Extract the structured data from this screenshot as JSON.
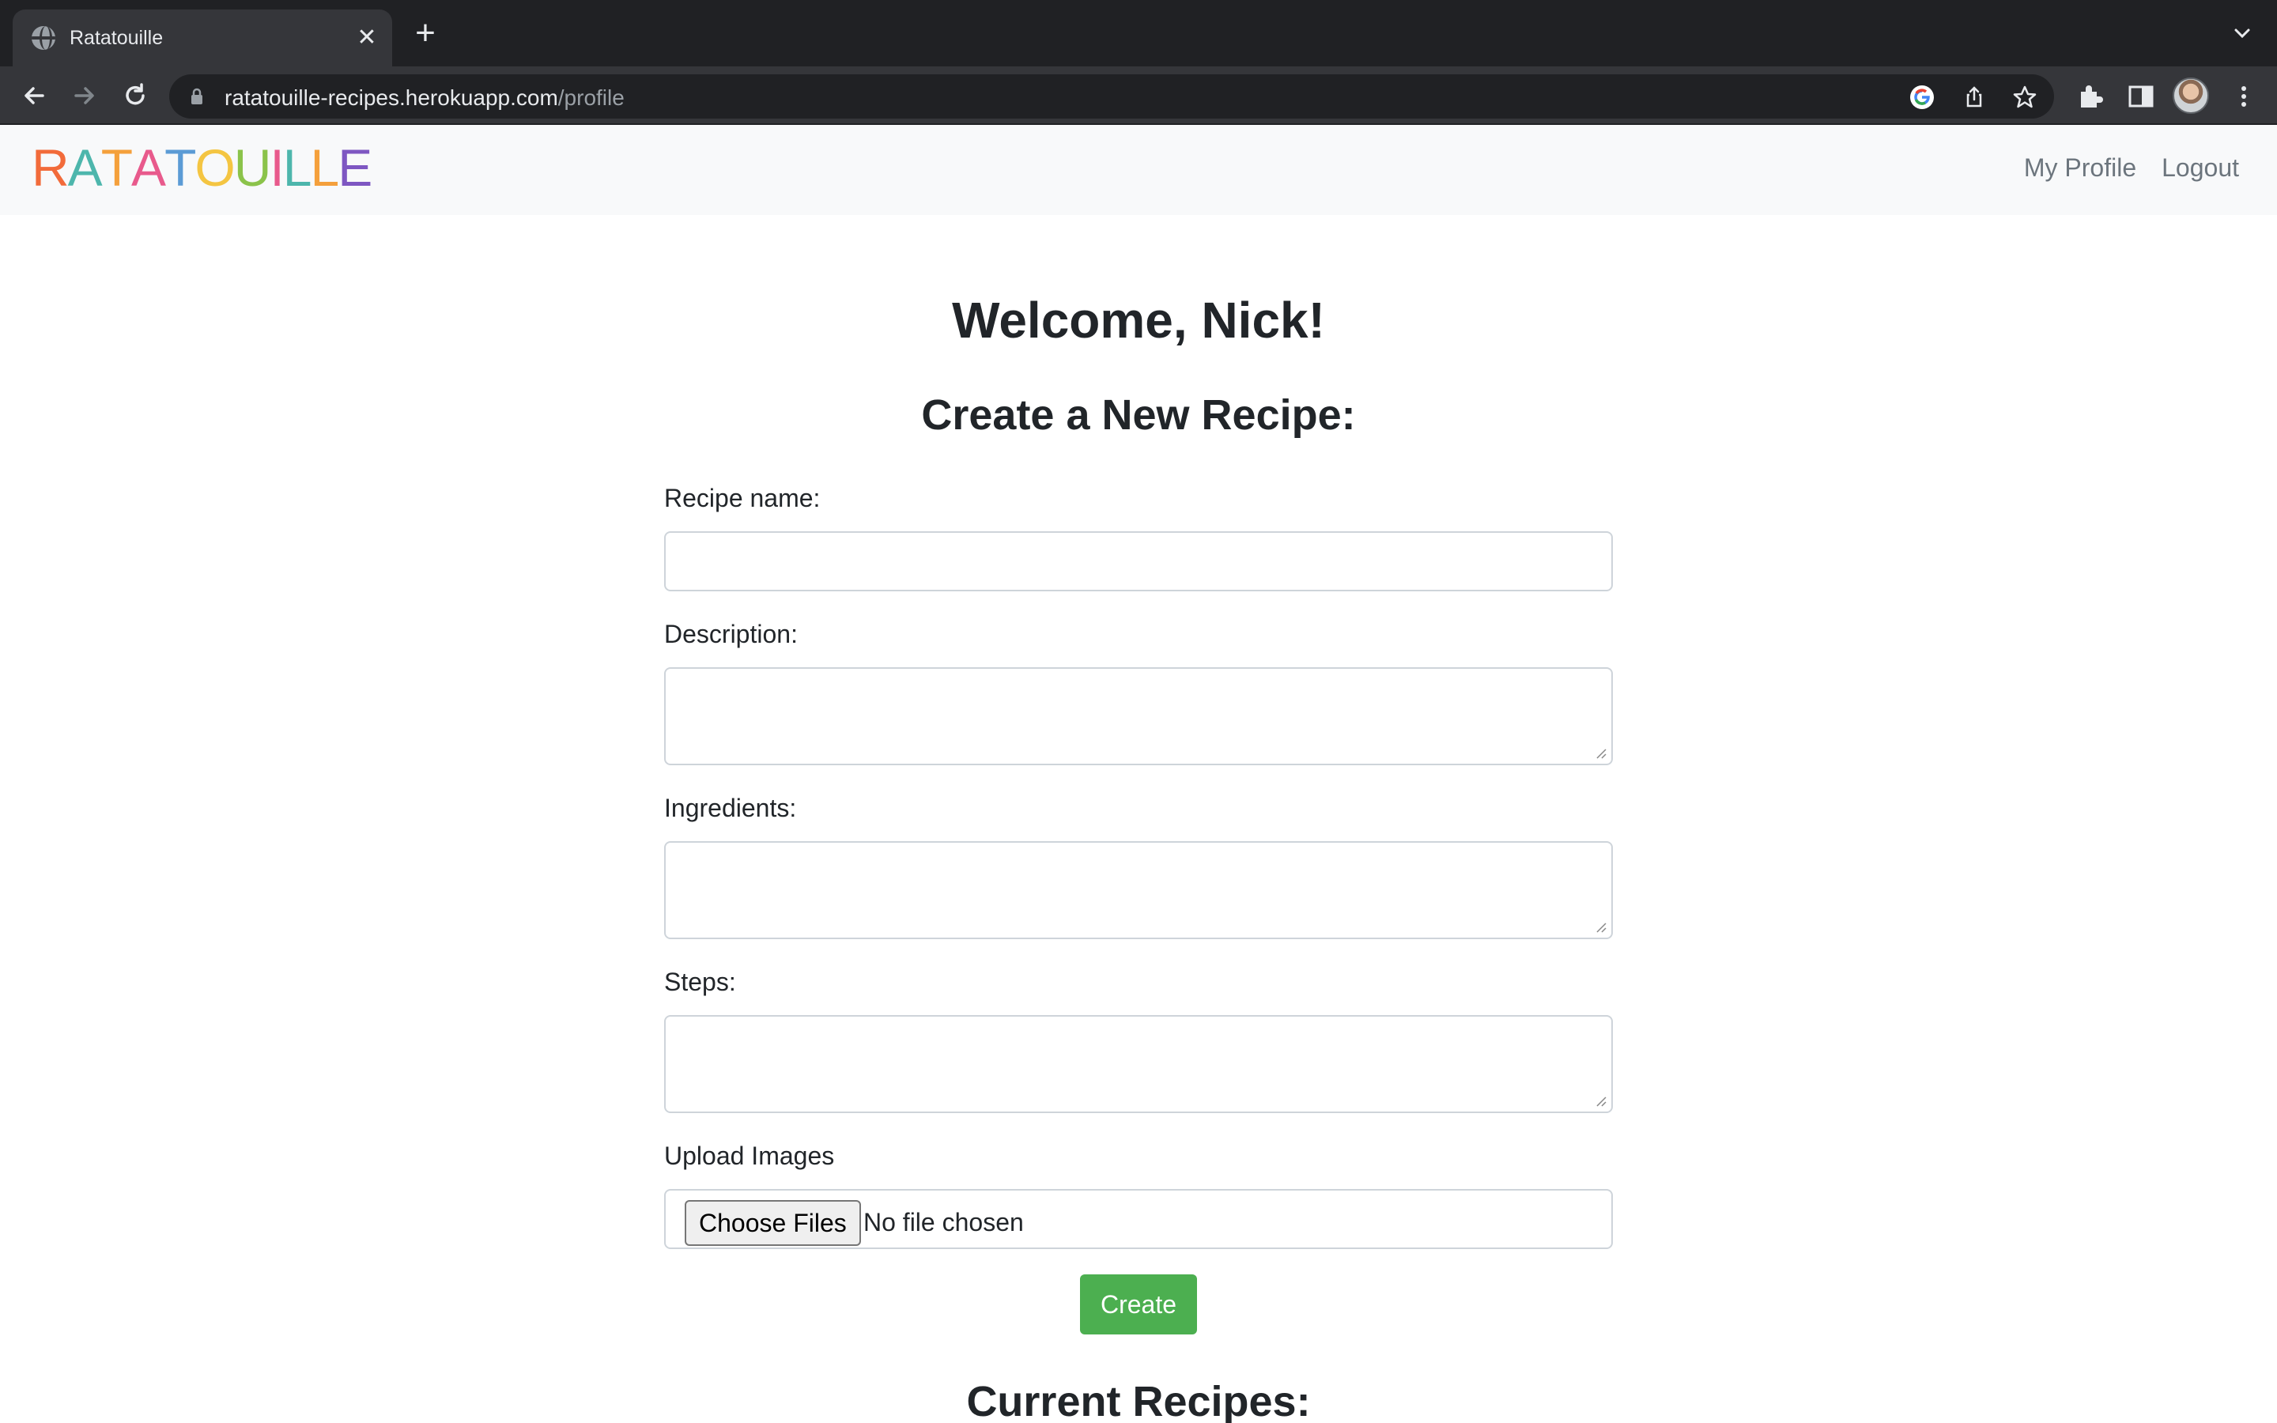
{
  "browser": {
    "tab_title": "Ratatouille",
    "url_host": "ratatouille-recipes.herokuapp.com",
    "url_path": "/profile"
  },
  "navbar": {
    "logo_letters": [
      "R",
      "A",
      "T",
      "A",
      "T",
      "O",
      "U",
      "I",
      "L",
      "L",
      "E"
    ],
    "logo_colors": [
      "#f26b3a",
      "#4db6ac",
      "#f4a03c",
      "#e85a8c",
      "#5b9bd5",
      "#f4c542",
      "#8bc34a",
      "#e85a8c",
      "#4db6ac",
      "#f4a03c",
      "#7e57c2"
    ],
    "links": [
      {
        "label": "My Profile"
      },
      {
        "label": "Logout"
      }
    ]
  },
  "main": {
    "welcome": "Welcome, Nick!",
    "create_heading": "Create a New Recipe:",
    "fields": {
      "recipe_name_label": "Recipe name:",
      "recipe_name_value": "",
      "description_label": "Description:",
      "description_value": "",
      "ingredients_label": "Ingredients:",
      "ingredients_value": "",
      "steps_label": "Steps:",
      "steps_value": "",
      "upload_label": "Upload Images",
      "choose_files": "Choose Files",
      "no_file": "No file chosen"
    },
    "create_button": "Create",
    "current_heading": "Current Recipes:"
  },
  "colors": {
    "create_button": "#4caf50",
    "navbar_bg": "#f8f9fa",
    "chrome_dark": "#202124"
  }
}
